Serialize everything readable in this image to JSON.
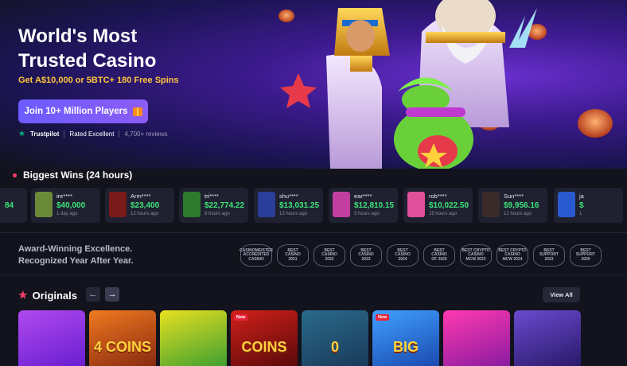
{
  "hero": {
    "title_line1": "World's Most",
    "title_line2": "Trusted Casino",
    "subtitle": "Get A$10,000 or 5BTC+ 180 Free Spins",
    "cta_label": "Join 10+ Million Players",
    "trust_brand": "Trustpilot",
    "trust_rating": "Rated Excellent",
    "trust_reviews": "4,700+ reviews"
  },
  "wins": {
    "title": "Biggest Wins (24 hours)",
    "partial_amount": "84",
    "items": [
      {
        "user": "ire****",
        "amount": "$40,000",
        "time": "1 day ago",
        "thumb": "#6a8a3a"
      },
      {
        "user": "Arm****",
        "amount": "$23,400",
        "time": "12 hours ago",
        "thumb": "#7a1a1a"
      },
      {
        "user": "tri****",
        "amount": "$22,774.22",
        "time": "8 hours ago",
        "thumb": "#2e7a2e"
      },
      {
        "user": "shu****",
        "amount": "$13,031.25",
        "time": "13 hours ago",
        "thumb": "#2a3f9a"
      },
      {
        "user": "ear****",
        "amount": "$12,810.15",
        "time": "3 hours ago",
        "thumb": "#c23fa0"
      },
      {
        "user": "rob****",
        "amount": "$10,022.50",
        "time": "15 hours ago",
        "thumb": "#e0509a"
      },
      {
        "user": "Sun****",
        "amount": "$9,956.16",
        "time": "12 hours ago",
        "thumb": "#3a2a2a"
      },
      {
        "user": "ja",
        "amount": "$",
        "time": "1",
        "thumb": "#2a5ad0"
      }
    ]
  },
  "awards": {
    "line1": "Award-Winning Excellence.",
    "line2": "Recognized Year After Year.",
    "badges": [
      [
        "CASINOMEISTER",
        "ACCREDITED",
        "CASINO"
      ],
      [
        "BEST",
        "CASINO",
        "2021"
      ],
      [
        "BEST",
        "CASINO",
        "2022"
      ],
      [
        "BEST",
        "CASINO",
        "2023"
      ],
      [
        "BEST",
        "CASINO",
        "2024"
      ],
      [
        "BEST",
        "CASINO",
        "OF 2025"
      ],
      [
        "BEST CRYPTO",
        "CASINO",
        "MCW 2023"
      ],
      [
        "BEST CRYPTO",
        "CASINO",
        "MCW 2024"
      ],
      [
        "BEST",
        "SUPPORT",
        "2023"
      ],
      [
        "BEST",
        "SUPPORT",
        "2020"
      ]
    ]
  },
  "originals": {
    "title": "Originals",
    "prev": "←",
    "next": "→",
    "view_all": "View All",
    "new_label": "New",
    "tiles": [
      {
        "bg": "linear-gradient(160deg,#b04af0,#6a1ed0)",
        "text": ""
      },
      {
        "bg": "linear-gradient(160deg,#f07a20,#8a2a10)",
        "text": "4 COINS"
      },
      {
        "bg": "linear-gradient(160deg,#e8e020,#40a030)",
        "text": ""
      },
      {
        "bg": "linear-gradient(160deg,#d0201a,#5a0a0a)",
        "text": "COINS",
        "new": true
      },
      {
        "bg": "linear-gradient(160deg,#2a6a8a,#1a3a5a)",
        "text": "0"
      },
      {
        "bg": "linear-gradient(160deg,#40a0ff,#1a4ab0)",
        "text": "BIG",
        "new": true
      },
      {
        "bg": "linear-gradient(160deg,#ff3ab0,#8a1aa0)",
        "text": ""
      },
      {
        "bg": "linear-gradient(160deg,#6a4ad0,#2a1a6a)",
        "text": ""
      }
    ]
  }
}
